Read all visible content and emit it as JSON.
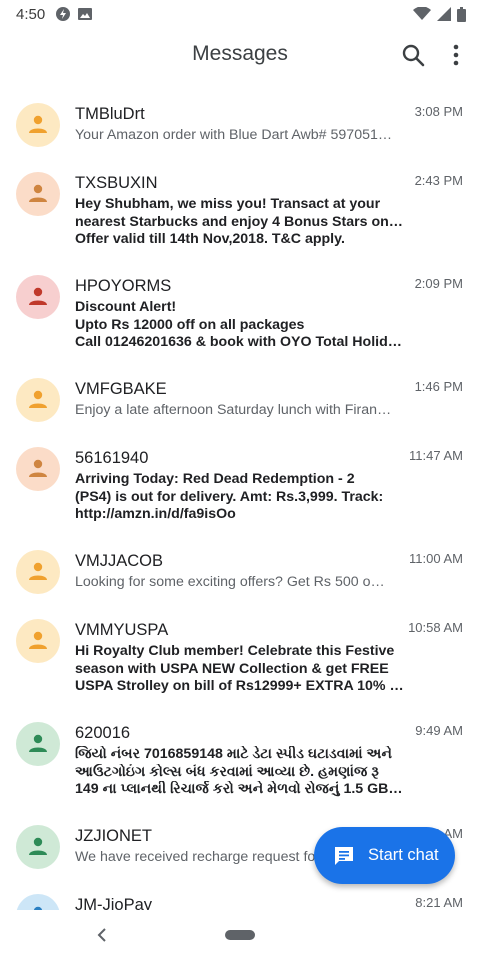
{
  "status_bar": {
    "time": "4:50"
  },
  "app_bar": {
    "title": "Messages",
    "search_icon": "search-icon",
    "menu_icon": "more-vert-icon"
  },
  "conversations": [
    {
      "sender": "TMBluDrt",
      "time": "3:08 PM",
      "unread": false,
      "avatar_color": "#fde9c2",
      "icon_color": "#f0a12e",
      "lines": [
        "Your Amazon order with Blue Dart Awb# 597051…"
      ]
    },
    {
      "sender": "TXSBUXIN",
      "time": "2:43 PM",
      "unread": true,
      "avatar_color": "#fbdcc8",
      "icon_color": "#cf8540",
      "lines": [
        "Hey Shubham, we miss you! Transact at your",
        "nearest Starbucks and enjoy 4 Bonus Stars on us!",
        "Offer valid till 14th Nov,2018. T&C apply."
      ]
    },
    {
      "sender": "HPOYORMS",
      "time": "2:09 PM",
      "unread": true,
      "avatar_color": "#f7cfcf",
      "icon_color": "#c0392b",
      "lines": [
        "Discount Alert!",
        "Upto Rs 12000 off on all packages",
        "Call 01246201636 & book with OYO Total Holid…"
      ]
    },
    {
      "sender": "VMFGBAKE",
      "time": "1:46 PM",
      "unread": false,
      "avatar_color": "#fde9c2",
      "icon_color": "#f0a12e",
      "lines": [
        "Enjoy a late afternoon Saturday lunch with Firan…"
      ]
    },
    {
      "sender": "56161940",
      "time": "11:47 AM",
      "unread": true,
      "avatar_color": "#fbdcc8",
      "icon_color": "#cf8540",
      "lines": [
        "Arriving Today: Red Dead Redemption - 2",
        "(PS4) is out for delivery. Amt: Rs.3,999. Track:",
        "http://amzn.in/d/fa9isOo"
      ]
    },
    {
      "sender": "VMJJACOB",
      "time": "11:00 AM",
      "unread": false,
      "avatar_color": "#fde9c2",
      "icon_color": "#f0a12e",
      "lines": [
        "Looking for some exciting offers? Get Rs 500 o…"
      ]
    },
    {
      "sender": "VMMYUSPA",
      "time": "10:58 AM",
      "unread": true,
      "avatar_color": "#fde9c2",
      "icon_color": "#f0a12e",
      "lines": [
        "Hi Royalty Club member! Celebrate this Festive",
        "season with USPA NEW Collection & get FREE",
        "USPA Strolley on bill of Rs12999+ EXTRA 10% …"
      ]
    },
    {
      "sender": "620016",
      "time": "9:49 AM",
      "unread": true,
      "avatar_color": "#cfe9d6",
      "icon_color": "#2e8b57",
      "lines": [
        "જિયો નંબર 7016859148 માટે ડેટા સ્પીડ ઘટાડવામાં અને",
        "આઉટગોઇંગ કોલ્સ બંધ કરવામાં આવ્યા છે. હમણાંજ રૂ",
        "149 ના પ્લાનથી રિચાર્જ કરો અને મેળવો રોજનું  1.5 GB …"
      ]
    },
    {
      "sender": "JZJIONET",
      "time": "9:49 AM",
      "unread": false,
      "avatar_color": "#cfe9d6",
      "icon_color": "#2e8b57",
      "lines": [
        "We have received recharge request fo…"
      ]
    },
    {
      "sender": "JM-JioPay",
      "time": "8:21 AM",
      "unread": false,
      "avatar_color": "#cde6f7",
      "icon_color": "#2a7fc2",
      "lines": [
        ""
      ]
    }
  ],
  "fab": {
    "label": "Start chat",
    "icon": "chat-icon"
  },
  "nav_bar": {
    "back_icon": "back-icon",
    "home_icon": "home-pill-icon"
  }
}
